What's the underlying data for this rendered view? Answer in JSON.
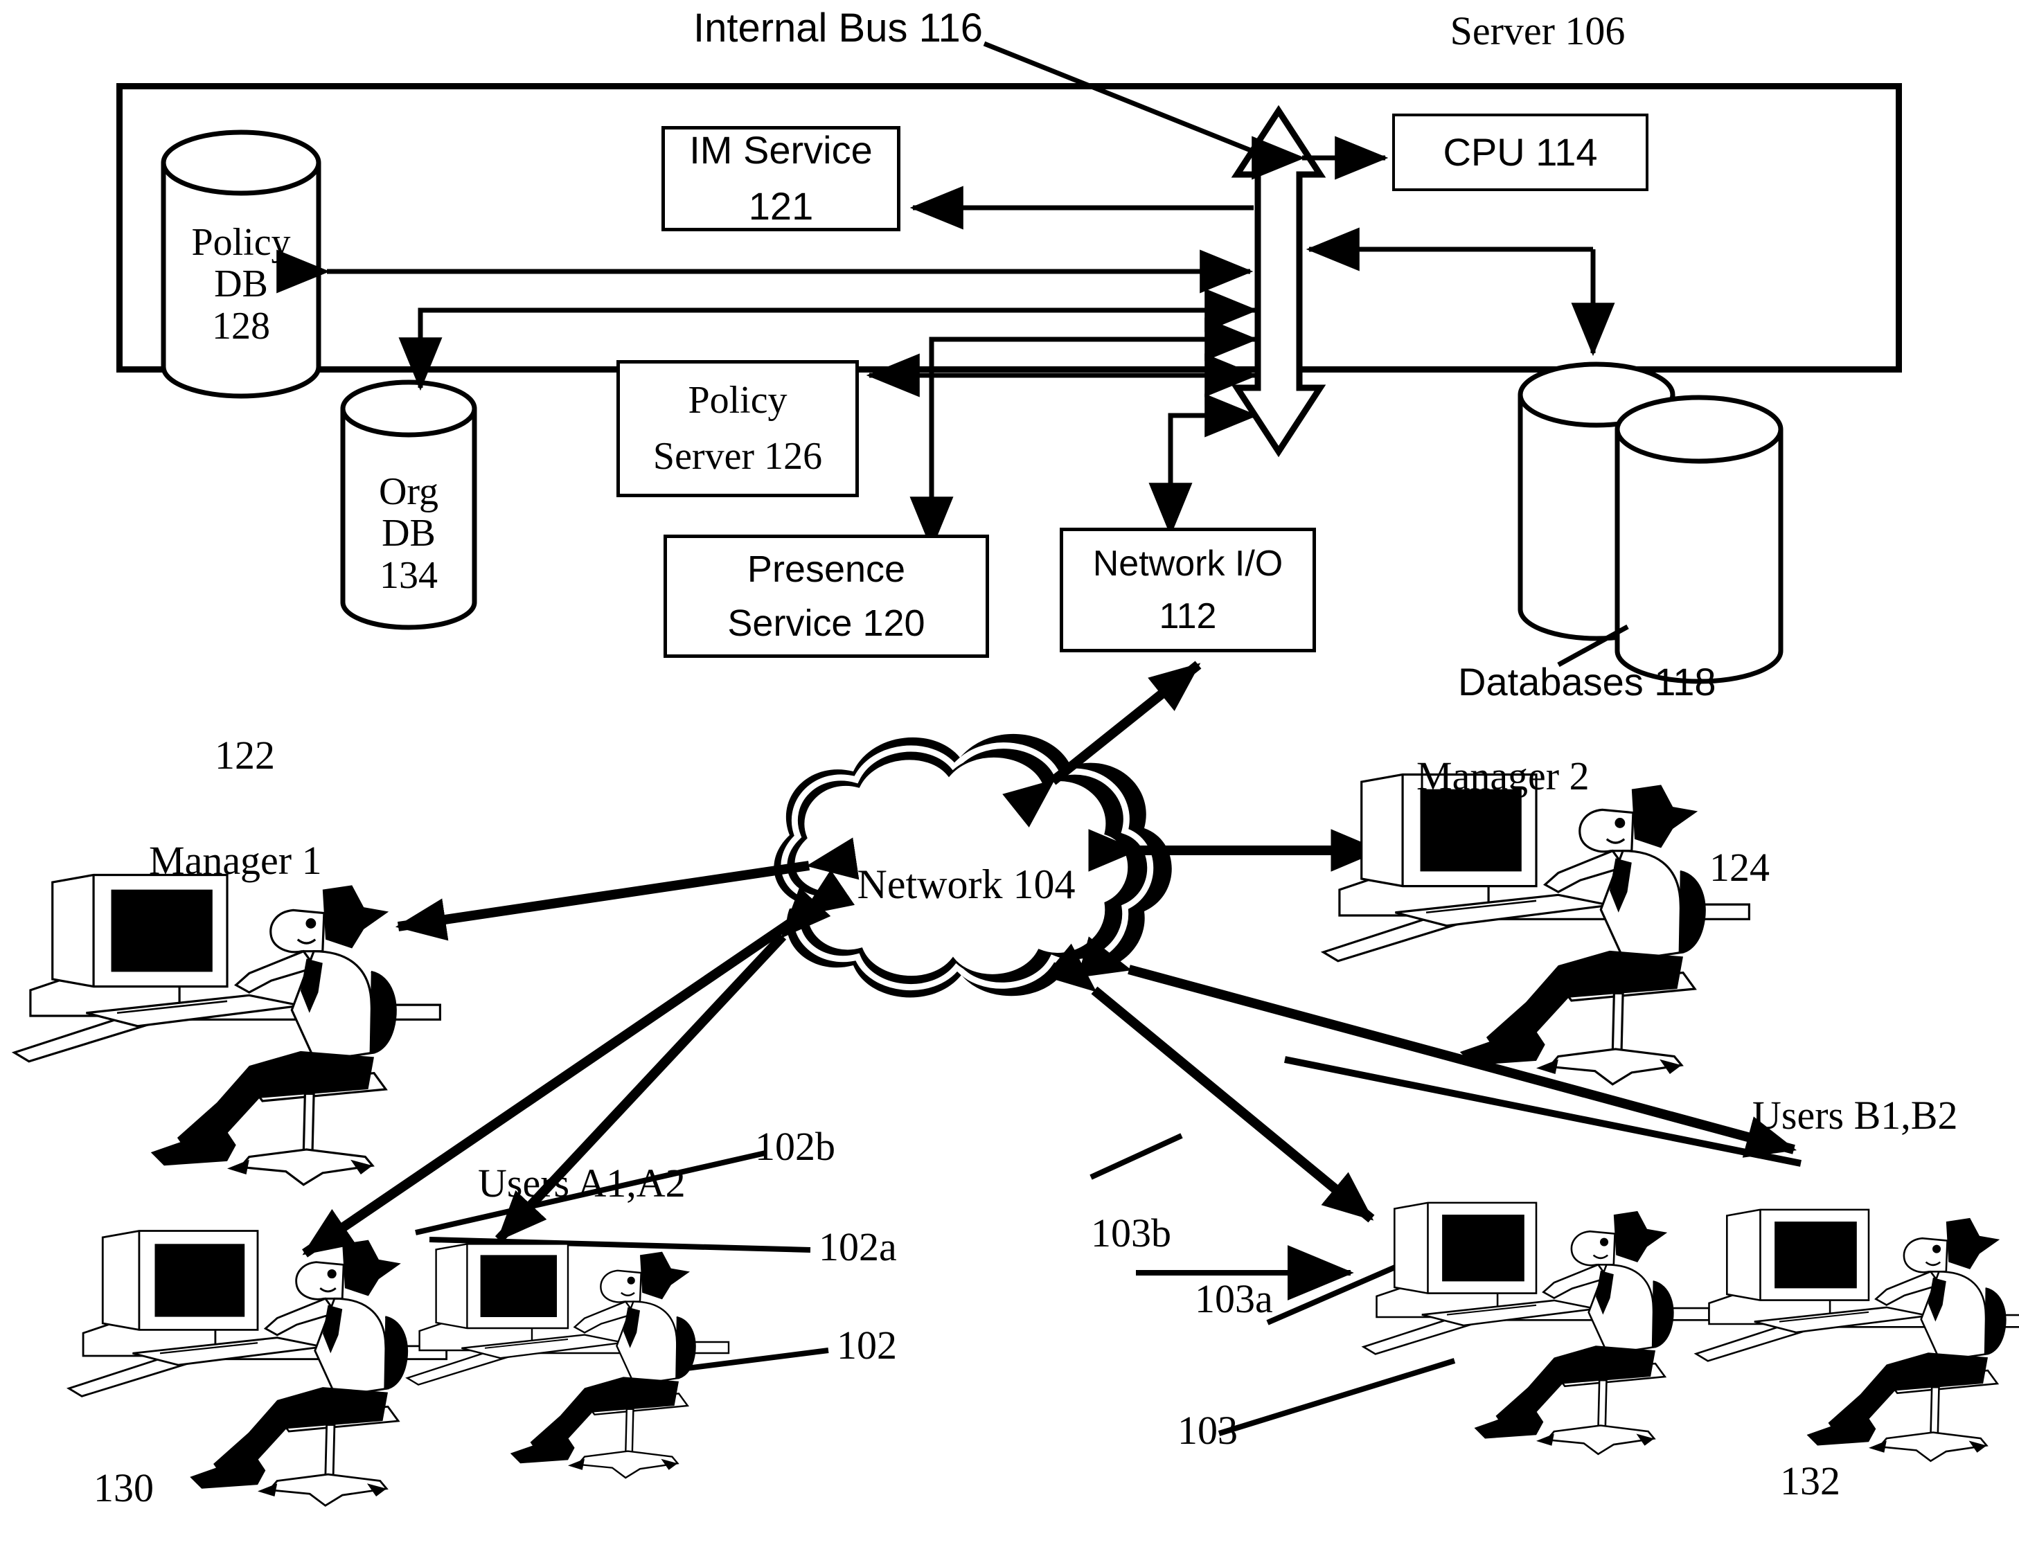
{
  "figure": {
    "domain": "patent-diagram",
    "title_labels": {
      "internal_bus": "Internal Bus 116",
      "server": "Server 106",
      "databases": "Databases 118"
    }
  },
  "server": {
    "label": "Server 106",
    "components": [
      {
        "id": "im_service",
        "line1": "IM Service",
        "line2": "121",
        "shape": "box"
      },
      {
        "id": "cpu",
        "line1": "CPU 114",
        "line2": "",
        "shape": "box"
      },
      {
        "id": "policy_server",
        "line1": "Policy",
        "line2": "Server 126",
        "shape": "box"
      },
      {
        "id": "presence_service",
        "line1": "Presence",
        "line2": "Service 120",
        "shape": "box"
      },
      {
        "id": "network_io",
        "line1": "Network I/O",
        "line2": "112",
        "shape": "box"
      },
      {
        "id": "policy_db",
        "line1": "Policy",
        "line2": "DB",
        "line3": "128",
        "shape": "cylinder"
      },
      {
        "id": "org_db",
        "line1": "Org",
        "line2": "DB",
        "line3": "134",
        "shape": "cylinder"
      },
      {
        "id": "databases",
        "line1": "Databases 118",
        "line2": "",
        "shape": "double-cylinder"
      }
    ],
    "bus": {
      "label": "Internal Bus 116",
      "style": "vertical-double-arrow"
    }
  },
  "network": {
    "label": "Network 104",
    "shape": "cloud"
  },
  "endpoints": [
    {
      "id": "manager1",
      "label": "Manager 1",
      "ref": "122"
    },
    {
      "id": "manager2",
      "label": "Manager 2",
      "ref": "124"
    },
    {
      "id": "usersA",
      "label": "Users A1,A2",
      "ref": "102"
    },
    {
      "id": "usersB",
      "label": "Users B1,B2",
      "ref": "103"
    }
  ],
  "callouts": {
    "ref_122": "122",
    "ref_124": "124",
    "ref_130": "130",
    "ref_132": "132",
    "ref_102": "102",
    "ref_102a": "102a",
    "ref_102b": "102b",
    "ref_103": "103",
    "ref_103a": "103a",
    "ref_103b": "103b",
    "manager1": "Manager 1",
    "manager2": "Manager 2",
    "users_a": "Users A1,A2",
    "users_b": "Users B1,B2",
    "network": "Network 104",
    "databases": "Databases 118",
    "internal_bus": "Internal Bus 116",
    "server": "Server 106"
  },
  "boxes": {
    "im_service_l1": "IM Service",
    "im_service_l2": "121",
    "cpu": "CPU 114",
    "policy_server_l1": "Policy",
    "policy_server_l2": "Server 126",
    "presence_l1": "Presence",
    "presence_l2": "Service 120",
    "netio_l1": "Network I/O",
    "netio_l2": "112",
    "policy_db_l1": "Policy",
    "policy_db_l2": "DB",
    "policy_db_l3": "128",
    "org_db_l1": "Org",
    "org_db_l2": "DB",
    "org_db_l3": "134"
  },
  "colors": {
    "ink": "#000000",
    "paper": "#ffffff"
  }
}
